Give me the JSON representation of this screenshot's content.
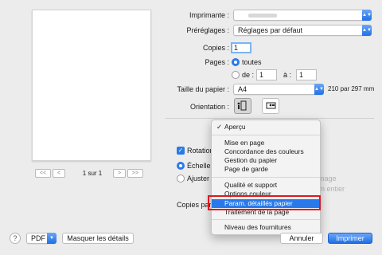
{
  "preview": {
    "page_indicator": "1 sur 1",
    "first_label": "<<",
    "prev_label": "<",
    "next_label": ">",
    "last_label": ">>"
  },
  "printer": {
    "label": "Imprimante :",
    "value": ""
  },
  "presets": {
    "label": "Préréglages :",
    "value": "Réglages par défaut"
  },
  "copies": {
    "label": "Copies :",
    "value": "1"
  },
  "pages": {
    "label": "Pages :",
    "all_label": "toutes",
    "from_label": "de :",
    "from_value": "1",
    "to_label": "à :",
    "to_value": "1"
  },
  "paper": {
    "label": "Taille du papier :",
    "value": "A4",
    "dimensions": "210 par 297 mm"
  },
  "orientation": {
    "label": "Orientation :"
  },
  "behind": {
    "rotation_label": "Rotation",
    "rotation_tail": "s",
    "scale_label": "Échelle :",
    "adjust_label": "Ajuster :",
    "image_label": "image",
    "fill_label": "en entier",
    "copies_per_label": "Copies par"
  },
  "menu": {
    "items": [
      {
        "label": "Aperçu",
        "checked": true
      },
      {
        "label": "Mise en page"
      },
      {
        "label": "Concordance des couleurs"
      },
      {
        "label": "Gestion du papier"
      },
      {
        "label": "Page de garde"
      },
      {
        "label": "Qualité et support"
      },
      {
        "label": "Options couleur"
      },
      {
        "label": "Param. détaillés papier",
        "highlighted": true
      },
      {
        "label": "Traitement de la page"
      },
      {
        "label": "Niveau des fournitures"
      }
    ],
    "check_glyph": "✓"
  },
  "footer": {
    "help": "?",
    "pdf_label": "PDF",
    "hide_details": "Masquer les détails",
    "cancel": "Annuler",
    "print": "Imprimer"
  },
  "colors": {
    "accent": "#2a79ea",
    "highlight_border": "#e0171f"
  }
}
